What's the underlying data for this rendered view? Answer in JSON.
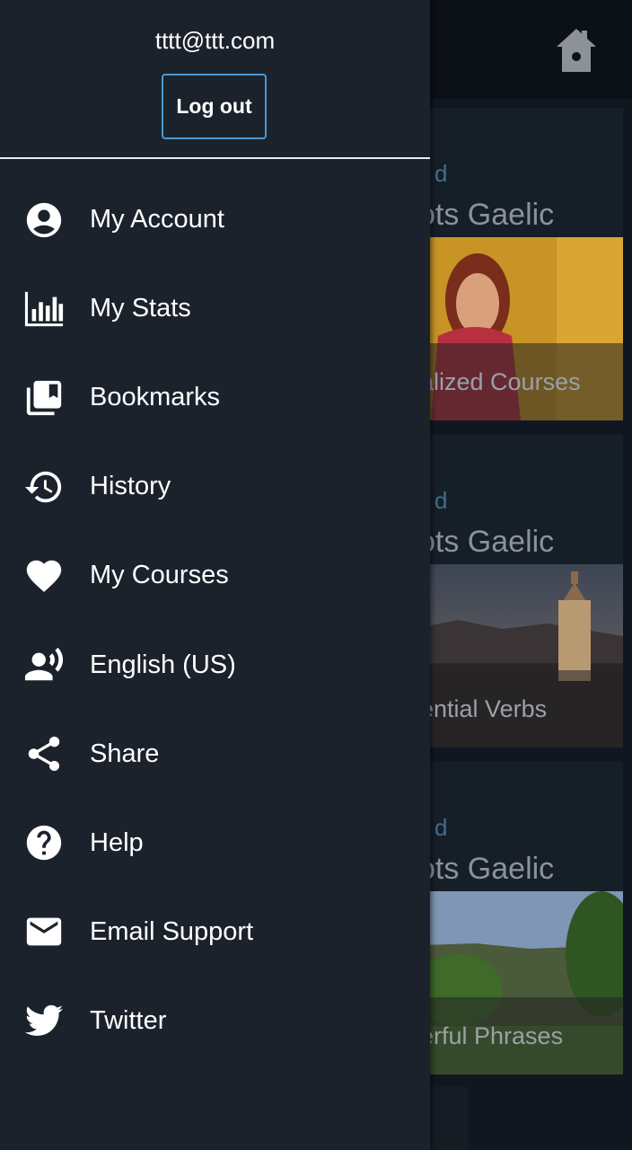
{
  "drawer": {
    "email": "tttt@ttt.com",
    "logout_label": "Log out",
    "menu": [
      {
        "label": "My Account",
        "icon": "account-circle-icon"
      },
      {
        "label": "My Stats",
        "icon": "stats-chart-icon"
      },
      {
        "label": "Bookmarks",
        "icon": "bookmarks-icon"
      },
      {
        "label": "History",
        "icon": "history-icon"
      },
      {
        "label": "My Courses",
        "icon": "heart-icon"
      },
      {
        "label": "English (US)",
        "icon": "voice-user-icon"
      },
      {
        "label": "Share",
        "icon": "share-icon"
      },
      {
        "label": "Help",
        "icon": "help-circle-icon"
      },
      {
        "label": "Email Support",
        "icon": "email-icon"
      },
      {
        "label": "Twitter",
        "icon": "twitter-icon"
      }
    ]
  },
  "background": {
    "home_icon": "home-icon",
    "cards": [
      {
        "kicker": "d",
        "title": "ots Gaelic",
        "caption": "alized Courses"
      },
      {
        "kicker": "d",
        "title": "ots Gaelic",
        "caption": "ential Verbs"
      },
      {
        "kicker": "d",
        "title": "ots Gaelic",
        "caption": "erful Phrases"
      }
    ]
  },
  "colors": {
    "drawer_bg": "#1c222c",
    "accent_border": "#4a9ad0",
    "text": "#ffffff"
  }
}
